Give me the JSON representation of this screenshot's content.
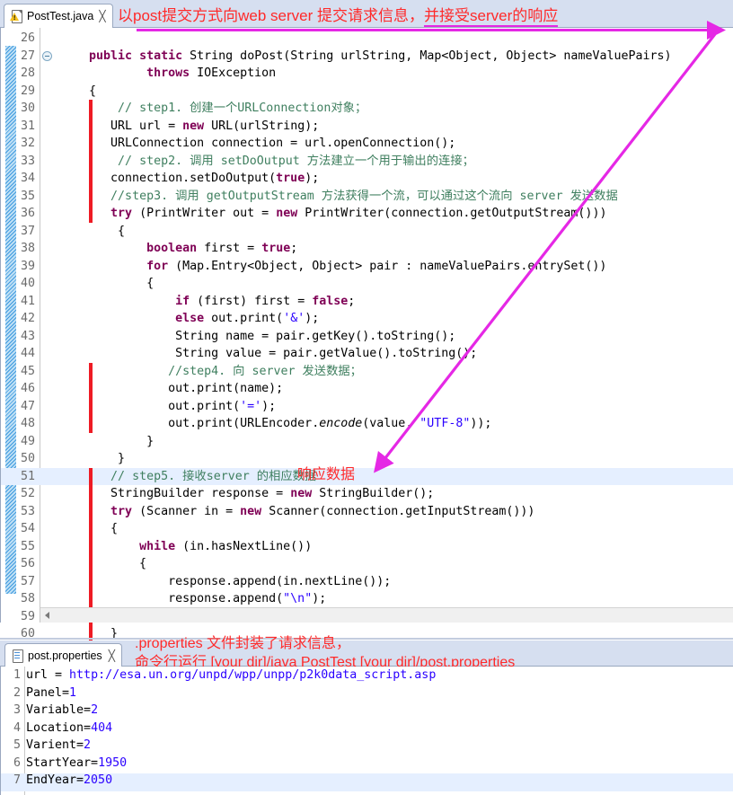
{
  "editor": {
    "tab": {
      "label": "PostTest.java",
      "close": "╳",
      "icon": "java-warning-file-icon"
    },
    "annotation_title": {
      "plain": "以post提交方式向web server 提交请求信息，",
      "underlined": "并接受server的响应"
    },
    "first_visible_line": 26,
    "current_line": 51,
    "lines": [
      {
        "n": 26,
        "text": ""
      },
      {
        "n": 27,
        "text": "    public static String doPost(String urlString, Map<Object, Object> nameValuePairs)",
        "fold": true
      },
      {
        "n": 28,
        "text": "            throws IOException"
      },
      {
        "n": 29,
        "text": "    {"
      },
      {
        "n": 30,
        "text": "        // step1. 创建一个URLConnection对象；"
      },
      {
        "n": 31,
        "text": "       URL url = new URL(urlString);"
      },
      {
        "n": 32,
        "text": "       URLConnection connection = url.openConnection();"
      },
      {
        "n": 33,
        "text": "        // step2. 调用 setDoOutput 方法建立一个用于输出的连接；"
      },
      {
        "n": 34,
        "text": "       connection.setDoOutput(true);"
      },
      {
        "n": 35,
        "text": "       //step3. 调用 getOutputStream 方法获得一个流，可以通过这个流向 server 发送数据"
      },
      {
        "n": 36,
        "text": "       try (PrintWriter out = new PrintWriter(connection.getOutputStream()))"
      },
      {
        "n": 37,
        "text": "        {"
      },
      {
        "n": 38,
        "text": "            boolean first = true;"
      },
      {
        "n": 39,
        "text": "            for (Map.Entry<Object, Object> pair : nameValuePairs.entrySet())"
      },
      {
        "n": 40,
        "text": "            {"
      },
      {
        "n": 41,
        "text": "                if (first) first = false;"
      },
      {
        "n": 42,
        "text": "                else out.print('&');"
      },
      {
        "n": 43,
        "text": "                String name = pair.getKey().toString();"
      },
      {
        "n": 44,
        "text": "                String value = pair.getValue().toString();"
      },
      {
        "n": 45,
        "text": "               //step4. 向 server 发送数据；"
      },
      {
        "n": 46,
        "text": "               out.print(name);"
      },
      {
        "n": 47,
        "text": "               out.print('=');"
      },
      {
        "n": 48,
        "text": "               out.print(URLEncoder.encode(value, \"UTF-8\"));"
      },
      {
        "n": 49,
        "text": "            }"
      },
      {
        "n": 50,
        "text": "        }"
      },
      {
        "n": 51,
        "text": "       // step5. 接收server 的相应数据"
      },
      {
        "n": 52,
        "text": "       StringBuilder response = new StringBuilder();"
      },
      {
        "n": 53,
        "text": "       try (Scanner in = new Scanner(connection.getInputStream()))"
      },
      {
        "n": 54,
        "text": "       {"
      },
      {
        "n": 55,
        "text": "           while (in.hasNextLine())"
      },
      {
        "n": 56,
        "text": "           {"
      },
      {
        "n": 57,
        "text": "               response.append(in.nextLine());"
      },
      {
        "n": 58,
        "text": "               response.append(\"\\n\");"
      },
      {
        "n": 59,
        "text": "           }"
      },
      {
        "n": 60,
        "text": "       }"
      }
    ],
    "inline_annotation": "响应数据"
  },
  "properties": {
    "tab": {
      "label": "post.properties",
      "close": "╳",
      "icon": "properties-file-icon"
    },
    "annotation": {
      "line1": ".properties 文件封装了请求信息，",
      "line2": "命令行运行 [your dir]/java PostTest [your dir]/post.properties"
    },
    "current_line": 7,
    "lines": [
      {
        "n": 1,
        "key": "url = ",
        "value": "http://esa.un.org/unpd/wpp/unpp/p2k0data_script.asp"
      },
      {
        "n": 2,
        "key": "Panel=",
        "value": "1"
      },
      {
        "n": 3,
        "key": "Variable=",
        "value": "2"
      },
      {
        "n": 4,
        "key": "Location=",
        "value": "404"
      },
      {
        "n": 5,
        "key": "Varient=",
        "value": "2"
      },
      {
        "n": 6,
        "key": "StartYear=",
        "value": "1950"
      },
      {
        "n": 7,
        "key": "EndYear=",
        "value": "2050"
      }
    ]
  },
  "colors": {
    "annotation_red": "#ff2a2a",
    "arrow_magenta": "#e528e5",
    "block_marker_red": "#ee1b24",
    "tab_bar": "#d6dff0",
    "current_line_highlight": "#e5efff",
    "keyword": "#7f0055",
    "string": "#2a00ff",
    "comment": "#3f7f5f"
  }
}
